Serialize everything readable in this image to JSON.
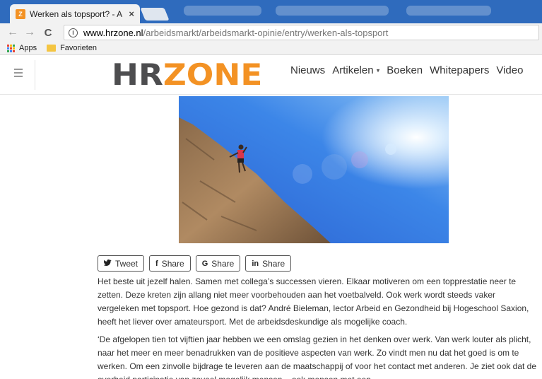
{
  "browser": {
    "tab_title": "Werken als topsport? - A",
    "tab_close": "×",
    "url_host": "www.hrzone.nl",
    "url_path": "/arbeidsmarkt/arbeidsmarkt-opinie/entry/werken-als-topsport",
    "bookmarks": [
      {
        "label": "Apps",
        "icon": "apps-grid-icon"
      },
      {
        "label": "Favorieten",
        "icon": "folder-icon"
      }
    ],
    "icons": {
      "back": "←",
      "forward": "→",
      "reload": "C",
      "info": "i"
    }
  },
  "site": {
    "logo_hr": "HR",
    "logo_zone": "ZONE",
    "nav": [
      {
        "label": "Nieuws"
      },
      {
        "label": "Artikelen",
        "caret": "▾"
      },
      {
        "label": "Boeken"
      },
      {
        "label": "Whitepapers"
      },
      {
        "label": "Video"
      }
    ],
    "brand_color": "#f39224"
  },
  "share_buttons": [
    {
      "label": "Tweet",
      "icon": "twitter-icon",
      "glyph": "🐦"
    },
    {
      "label": "Share",
      "icon": "facebook-icon",
      "glyph": "f"
    },
    {
      "label": "Share",
      "icon": "google-icon",
      "glyph": "G"
    },
    {
      "label": "Share",
      "icon": "linkedin-icon",
      "glyph": "in"
    }
  ],
  "article": {
    "paragraphs": [
      "Het beste uit jezelf halen. Samen met collega’s successen vieren. Elkaar motiveren om een topprestatie neer te zetten. Deze kreten zijn allang niet meer voorbehouden aan het voetbalveld. Ook werk wordt steeds vaker vergeleken met topsport. Hoe gezond is dat? André Bieleman, lector Arbeid en Gezondheid bij Hogeschool Saxion, heeft het liever over amateursport. Met de arbeidsdeskundige als mogelijke coach.",
      "‘De afgelopen tien tot vijftien jaar hebben we een omslag gezien in het denken over werk. Van werk louter als plicht, naar het meer en meer benadrukken van de positieve aspecten van werk. Zo vindt men nu dat het goed is om te werken. Om een zinvolle bijdrage te leveren aan de maatschappij of voor het contact met anderen. Je ziet ook dat de overheid participatie van zoveel mogelijk mensen – ook mensen met een"
    ]
  }
}
